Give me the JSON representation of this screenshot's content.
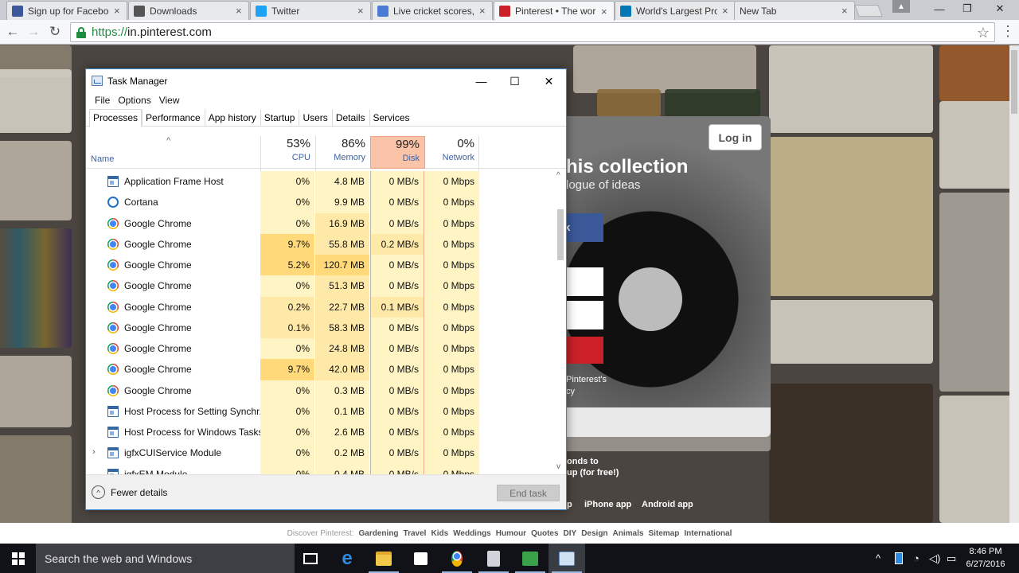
{
  "browser": {
    "tabs": [
      {
        "label": "Sign up for Facebook",
        "favicon": "facebook",
        "color": "#3b5998",
        "active": false
      },
      {
        "label": "Downloads",
        "favicon": "download",
        "color": "#555555",
        "active": false
      },
      {
        "label": "Twitter",
        "favicon": "twitter",
        "color": "#1da1f2",
        "active": false
      },
      {
        "label": "Live cricket scores, c",
        "favicon": "cricket",
        "color": "#4b7bd4",
        "active": false
      },
      {
        "label": "Pinterest • The worl",
        "favicon": "pinterest",
        "color": "#cb2027",
        "active": true
      },
      {
        "label": "World's Largest Pro",
        "favicon": "linkedin",
        "color": "#0077b5",
        "active": false
      },
      {
        "label": "New Tab",
        "favicon": "none",
        "color": "#ffffff",
        "active": false
      }
    ],
    "url_scheme": "https://",
    "url_host": "in.pinterest.com",
    "window_controls": {
      "minimize": "—",
      "restore": "❐",
      "close": "✕"
    }
  },
  "pinterest": {
    "login_button": "Log in",
    "modal_title": "his collection",
    "modal_subtitle": "logue of ideas",
    "facebook_btn": "ok",
    "terms_1": "Pinterest's",
    "terms_2": "cy",
    "promo_1": "onds to",
    "promo_2": "up (for free!)",
    "app_links": [
      "p",
      "iPhone app",
      "Android app"
    ],
    "discover_lead": "Discover Pinterest:",
    "discover_links": [
      "Gardening",
      "Travel",
      "Kids",
      "Weddings",
      "Humour",
      "Quotes",
      "DIY",
      "Design",
      "Animals",
      "Sitemap",
      "International"
    ]
  },
  "task_manager": {
    "title": "Task Manager",
    "menu": [
      "File",
      "Options",
      "View"
    ],
    "tabs": [
      "Processes",
      "Performance",
      "App history",
      "Startup",
      "Users",
      "Details",
      "Services"
    ],
    "active_tab": "Processes",
    "columns": {
      "name": "Name",
      "cpu": {
        "pct": "53%",
        "label": "CPU"
      },
      "memory": {
        "pct": "86%",
        "label": "Memory"
      },
      "disk": {
        "pct": "99%",
        "label": "Disk"
      },
      "network": {
        "pct": "0%",
        "label": "Network"
      }
    },
    "rows": [
      {
        "name": "Application Frame Host",
        "icon": "window",
        "cpu": "0%",
        "mem": "4.8 MB",
        "disk": "0 MB/s",
        "net": "0 Mbps"
      },
      {
        "name": "Cortana",
        "icon": "cortana",
        "cpu": "0%",
        "mem": "9.9 MB",
        "disk": "0 MB/s",
        "net": "0 Mbps"
      },
      {
        "name": "Google Chrome",
        "icon": "chrome",
        "cpu": "0%",
        "mem": "16.9 MB",
        "disk": "0 MB/s",
        "net": "0 Mbps"
      },
      {
        "name": "Google Chrome",
        "icon": "chrome",
        "cpu": "9.7%",
        "mem": "55.8 MB",
        "disk": "0.2 MB/s",
        "net": "0 Mbps"
      },
      {
        "name": "Google Chrome",
        "icon": "chrome",
        "cpu": "5.2%",
        "mem": "120.7 MB",
        "disk": "0 MB/s",
        "net": "0 Mbps"
      },
      {
        "name": "Google Chrome",
        "icon": "chrome",
        "cpu": "0%",
        "mem": "51.3 MB",
        "disk": "0 MB/s",
        "net": "0 Mbps"
      },
      {
        "name": "Google Chrome",
        "icon": "chrome",
        "cpu": "0.2%",
        "mem": "22.7 MB",
        "disk": "0.1 MB/s",
        "net": "0 Mbps"
      },
      {
        "name": "Google Chrome",
        "icon": "chrome",
        "cpu": "0.1%",
        "mem": "58.3 MB",
        "disk": "0 MB/s",
        "net": "0 Mbps"
      },
      {
        "name": "Google Chrome",
        "icon": "chrome",
        "cpu": "0%",
        "mem": "24.8 MB",
        "disk": "0 MB/s",
        "net": "0 Mbps"
      },
      {
        "name": "Google Chrome",
        "icon": "chrome",
        "cpu": "9.7%",
        "mem": "42.0 MB",
        "disk": "0 MB/s",
        "net": "0 Mbps"
      },
      {
        "name": "Google Chrome",
        "icon": "chrome",
        "cpu": "0%",
        "mem": "0.3 MB",
        "disk": "0 MB/s",
        "net": "0 Mbps"
      },
      {
        "name": "Host Process for Setting Synchr...",
        "icon": "window",
        "cpu": "0%",
        "mem": "0.1 MB",
        "disk": "0 MB/s",
        "net": "0 Mbps"
      },
      {
        "name": "Host Process for Windows Tasks",
        "icon": "window",
        "cpu": "0%",
        "mem": "2.6 MB",
        "disk": "0 MB/s",
        "net": "0 Mbps"
      },
      {
        "name": "igfxCUIService Module",
        "icon": "window",
        "cpu": "0%",
        "mem": "0.2 MB",
        "disk": "0 MB/s",
        "net": "0 Mbps",
        "expandable": true
      },
      {
        "name": "igfxEM Module",
        "icon": "window",
        "cpu": "0%",
        "mem": "0.4 MB",
        "disk": "0 MB/s",
        "net": "0 Mbps"
      }
    ],
    "fewer_details": "Fewer details",
    "end_task": "End task",
    "colors": {
      "light": "#fff4c4",
      "medium": "#ffe9a8",
      "heavy": "#ffd97a",
      "disk_header": "#fbc3a8",
      "disk_border": "#f0a27f",
      "accent": "#3f62a0"
    }
  },
  "taskbar": {
    "search_placeholder": "Search the web and Windows",
    "apps": [
      {
        "name": "task-view-icon",
        "glyph": "❐"
      },
      {
        "name": "edge-icon",
        "glyph": "e"
      },
      {
        "name": "file-explorer-icon",
        "glyph": "▬"
      },
      {
        "name": "store-icon",
        "glyph": "🛍"
      },
      {
        "name": "chrome-icon",
        "glyph": "●"
      },
      {
        "name": "clipboard-app-icon",
        "glyph": "▮"
      },
      {
        "name": "green-app-icon",
        "glyph": "▮"
      },
      {
        "name": "task-manager-icon",
        "glyph": "▣"
      }
    ],
    "clock_time": "8:46 PM",
    "clock_date": "6/27/2016"
  }
}
